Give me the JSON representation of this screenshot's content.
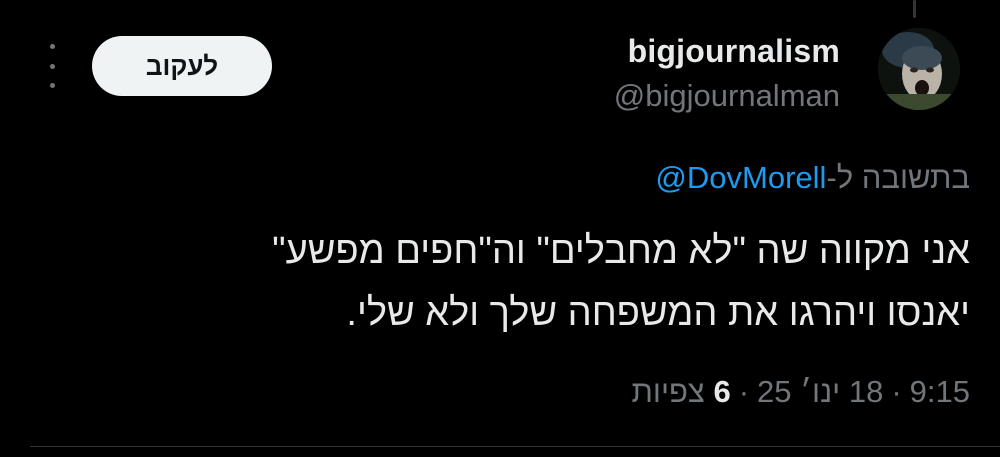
{
  "tweet": {
    "author": {
      "display_name": "bigjournalism",
      "handle": "@bigjournalman"
    },
    "follow_label": "לעקוב",
    "reply_to": {
      "prefix": "בתשובה ל-",
      "mention": "@DovMorell"
    },
    "text_line_1": "אני מקווה שה \"לא מחבלים\" וה\"חפים מפשע\"",
    "text_line_2": "יאנסו ויהרגו את המשפחה שלך ולא שלי.",
    "meta": {
      "time": "9:15",
      "date": "18 ינו׳ 25",
      "views_count": "6",
      "views_label": "צפיות"
    }
  },
  "colors": {
    "background": "#000000",
    "primary_text": "#e7e9ea",
    "secondary_text": "#71767b",
    "link": "#1d9bf0",
    "follow_button_bg": "#eff3f4"
  }
}
